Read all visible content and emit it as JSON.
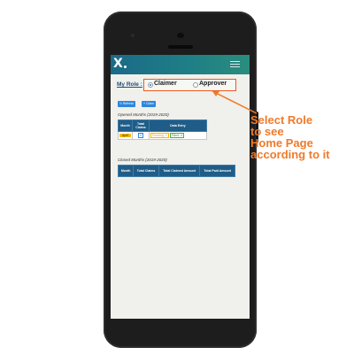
{
  "role_selector": {
    "label": "My Role :",
    "options": [
      {
        "label": "Claimer",
        "selected": true
      },
      {
        "label": "Approver",
        "selected": false
      }
    ]
  },
  "toolbar": {
    "refresh_label": "↻ Refresh",
    "add_label": "+ Claim"
  },
  "opened_months": {
    "title": "Opened Months  (2019-2020)",
    "headers": {
      "month": "Month",
      "total_claims": "Total Claims",
      "data_entry": "Data Entry"
    },
    "rows": [
      {
        "month": "April",
        "total": "5",
        "pending": "Pending: 1",
        "filled": "Filled: 4"
      }
    ]
  },
  "closed_months": {
    "title": "Closed Months  (2019-2020)",
    "headers": {
      "month": "Month",
      "total_claims": "Total Claims",
      "total_claimed": "Total Claimed Amount",
      "total_paid": "Total Paid Amount"
    }
  },
  "annotation": {
    "lines": [
      "Select Role",
      "to see",
      "Home Page",
      "according to it"
    ],
    "color": "#f07a2a"
  },
  "colors": {
    "header_gradient_start": "#1b6a88",
    "header_gradient_end": "#2a8d7d",
    "highlight_border": "#ee5a1e",
    "primary_button": "#2e86de",
    "table_header": "#1f5d88"
  }
}
